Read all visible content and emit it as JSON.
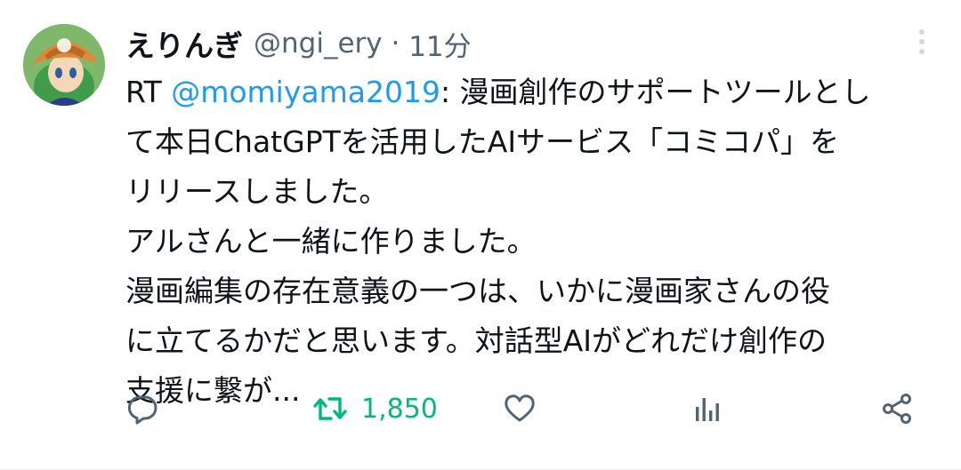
{
  "tweet": {
    "display_name": "えりんぎ",
    "handle": "@ngi_ery",
    "separator": "·",
    "time": "11分",
    "text": {
      "prefix": "RT ",
      "mention": "@momiyama2019",
      "line1_rest": ": 漫画創作のサポートツールとし",
      "line2": "て本日ChatGPTを活用したAIサービス「コミコパ」を",
      "line3": "リリースしました。",
      "line4": "アルさんと一緒に作りました。",
      "line5": "漫画編集の存在意義の一つは、いかに漫画家さんの役",
      "line6": "に立てるかだと思います。対話型AIがどれだけ創作の",
      "line7": "支援に繋が..."
    },
    "actions": {
      "reply_icon": "reply-icon",
      "retweet_icon": "retweet-icon",
      "retweet_count": "1,850",
      "like_icon": "heart-icon",
      "views_icon": "analytics-icon",
      "share_icon": "share-icon",
      "more_icon": "more-vertical-icon"
    },
    "colors": {
      "text": "#0f1419",
      "secondary": "#536471",
      "mention": "#1d9bf0",
      "retweet_active": "#00ba7c",
      "icon": "#536471"
    }
  }
}
